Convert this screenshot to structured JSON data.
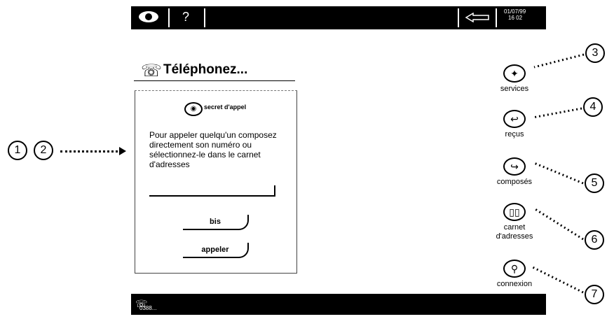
{
  "top_bar": {
    "date": "01/07/99",
    "time": "16 02",
    "help_glyph": "?"
  },
  "panel": {
    "title": "Téléphonez...",
    "secret_label": "secret d'appel",
    "instructions": "Pour appeler quelqu'un composez directement son numéro ou sélectionnez-le dans le carnet d'adresses",
    "redial_label": "bis",
    "call_label": "appeler"
  },
  "menu": [
    {
      "label": "services",
      "icon": "services-icon"
    },
    {
      "label": "reçus",
      "icon": "incoming-calls-icon"
    },
    {
      "label": "composés",
      "icon": "outgoing-calls-icon"
    },
    {
      "label": "carnet d'adresses",
      "icon": "address-book-icon"
    },
    {
      "label": "connexion",
      "icon": "connection-icon"
    }
  ],
  "bottom_bar": {
    "number": "0388..."
  },
  "callouts": [
    "1",
    "2",
    "3",
    "4",
    "5",
    "6",
    "7"
  ]
}
